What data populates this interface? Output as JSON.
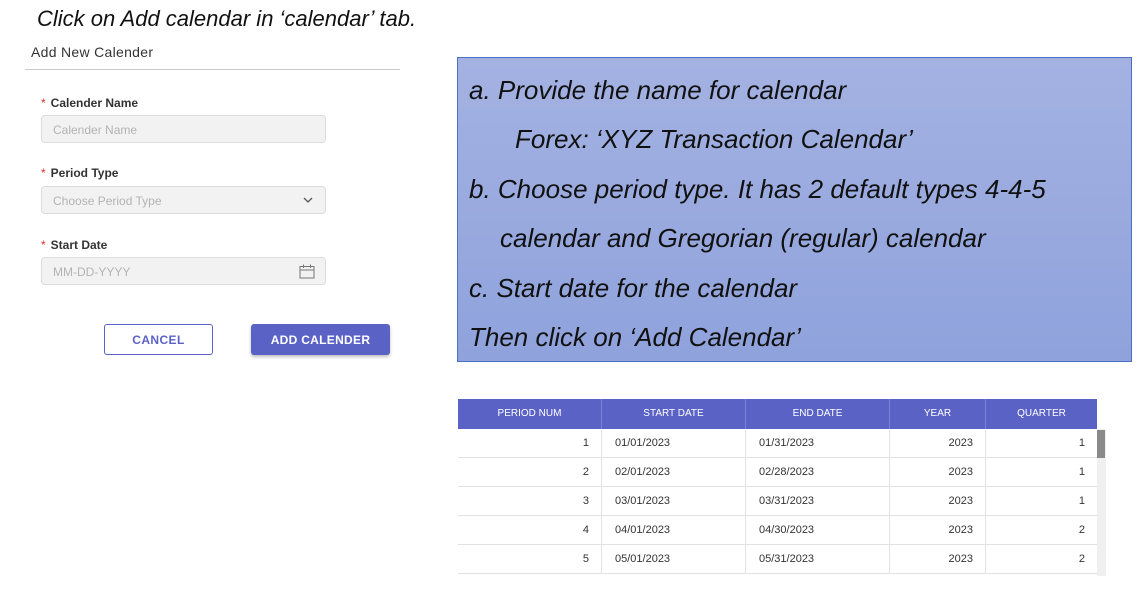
{
  "instruction": "Click on Add calendar in ‘calendar’ tab.",
  "dialog": {
    "title": "Add New Calender",
    "required_mark": "*",
    "fields": [
      {
        "label": "Calender Name",
        "placeholder": "Calender Name"
      },
      {
        "label": "Period Type",
        "placeholder": "Choose Period Type"
      },
      {
        "label": "Start Date",
        "placeholder": "MM-DD-YYYY"
      }
    ],
    "cancel_label": "CANCEL",
    "add_label": "ADD CALENDER"
  },
  "info": {
    "lines": [
      "a.  Provide the name for calendar",
      "Forex: ‘XYZ Transaction Calendar’",
      "b. Choose period type. It has 2 default types 4-4-5",
      "calendar and Gregorian (regular) calendar",
      "c. Start date for the calendar",
      "Then click on ‘Add Calendar’"
    ]
  },
  "table": {
    "headers": [
      "PERIOD NUM",
      "START DATE",
      "END DATE",
      "YEAR",
      "QUARTER"
    ],
    "rows": [
      [
        "1",
        "01/01/2023",
        "01/31/2023",
        "2023",
        "1"
      ],
      [
        "2",
        "02/01/2023",
        "02/28/2023",
        "2023",
        "1"
      ],
      [
        "3",
        "03/01/2023",
        "03/31/2023",
        "2023",
        "1"
      ],
      [
        "4",
        "04/01/2023",
        "04/30/2023",
        "2023",
        "2"
      ],
      [
        "5",
        "05/01/2023",
        "05/31/2023",
        "2023",
        "2"
      ]
    ]
  },
  "colors": {
    "accent": "#5b62c5",
    "required": "#d93030",
    "info_background": "#98a9df"
  }
}
